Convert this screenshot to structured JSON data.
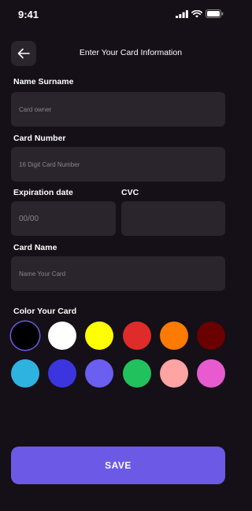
{
  "status_bar": {
    "time": "9:41",
    "icons": [
      "signal-icon",
      "wifi-icon",
      "battery-icon"
    ]
  },
  "header": {
    "back_icon": "arrow-left-icon",
    "title": "Enter Your Card Information"
  },
  "form": {
    "name": {
      "label": "Name Surname",
      "placeholder": "Card owner",
      "value": ""
    },
    "number": {
      "label": "Card Number",
      "placeholder": "16 Digit Card Number",
      "value": ""
    },
    "expiry": {
      "label": "Expiration date",
      "placeholder": "00/00",
      "value": ""
    },
    "cvc": {
      "label": "CVC",
      "placeholder": "",
      "value": ""
    },
    "card_name": {
      "label": "Card Name",
      "placeholder": "Name Your Card",
      "value": ""
    }
  },
  "colors": {
    "label": "Color Your Card",
    "selected_index": 0,
    "swatches": [
      "#000000",
      "#ffffff",
      "#ffff00",
      "#e02b2b",
      "#ff7a00",
      "#6b0000",
      "#2eb3e0",
      "#3b35e0",
      "#6a5ff0",
      "#21c25e",
      "#ffa3a3",
      "#e85bd0"
    ]
  },
  "save_label": "SAVE",
  "theme": {
    "background": "#150f17",
    "field": "#2a242c",
    "accent": "#6c5ae6"
  }
}
